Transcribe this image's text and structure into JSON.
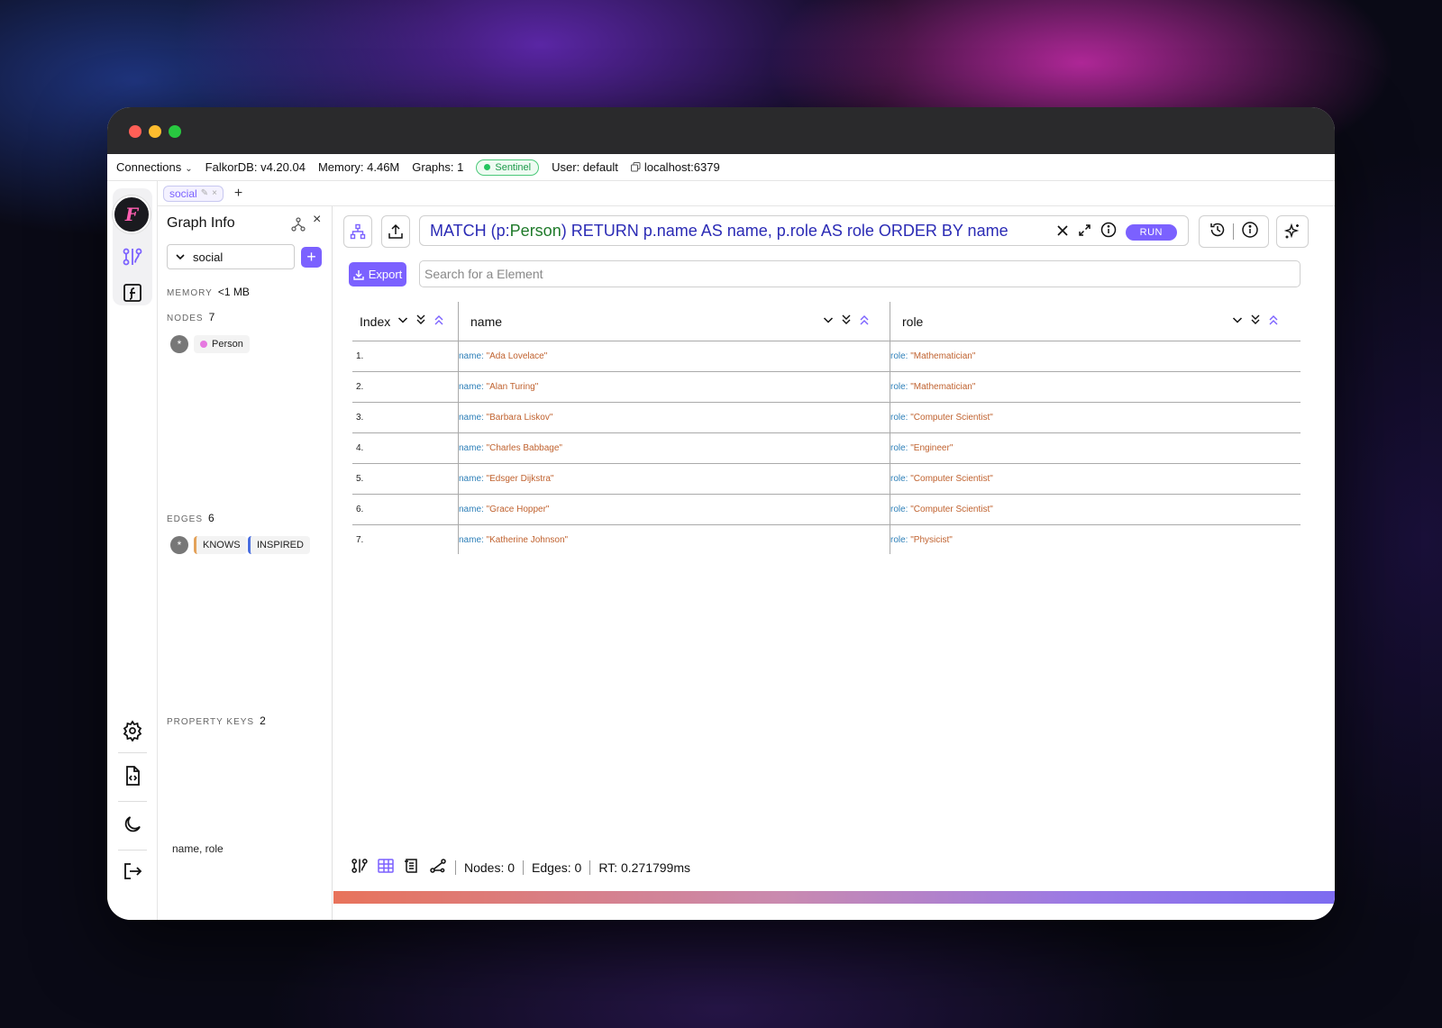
{
  "statusbar": {
    "connections_label": "Connections",
    "db_version": "FalkorDB: v4.20.04",
    "memory": "Memory: 4.46M",
    "graphs": "Graphs: 1",
    "badge": "Sentinel",
    "user": "User: default",
    "host": "localhost:6379"
  },
  "tabs": {
    "active_graph": "social",
    "add_label": "+"
  },
  "rail": {
    "logo_letter": "F"
  },
  "sidepanel": {
    "title": "Graph Info",
    "selected_graph": "social",
    "add_label": "+",
    "memory_label": "MEMORY",
    "memory_value": "<1 MB",
    "nodes_label": "NODES",
    "nodes_count": "7",
    "node_labels": [
      "Person"
    ],
    "edges_label": "EDGES",
    "edges_count": "6",
    "edge_types": [
      "KNOWS",
      "INSPIRED"
    ],
    "property_keys_label": "PROPERTY KEYS",
    "property_keys_count": "2",
    "property_keys": "name, role",
    "all_chip": "*"
  },
  "query": {
    "part1": "MATCH (p:",
    "label": "Person",
    "part2": ") RETURN p.name AS name, p.role AS role ORDER BY name",
    "run_label": "RUN"
  },
  "toolbar": {
    "export_label": "Export",
    "search_placeholder": "Search for a Element"
  },
  "table": {
    "columns": [
      "Index",
      "name",
      "role"
    ],
    "rows": [
      {
        "index": "1.",
        "name_key": "name:",
        "name": "\"Ada Lovelace\"",
        "role_key": "role:",
        "role": "\"Mathematician\""
      },
      {
        "index": "2.",
        "name_key": "name:",
        "name": "\"Alan Turing\"",
        "role_key": "role:",
        "role": "\"Mathematician\""
      },
      {
        "index": "3.",
        "name_key": "name:",
        "name": "\"Barbara Liskov\"",
        "role_key": "role:",
        "role": "\"Computer Scientist\""
      },
      {
        "index": "4.",
        "name_key": "name:",
        "name": "\"Charles Babbage\"",
        "role_key": "role:",
        "role": "\"Engineer\""
      },
      {
        "index": "5.",
        "name_key": "name:",
        "name": "\"Edsger Dijkstra\"",
        "role_key": "role:",
        "role": "\"Computer Scientist\""
      },
      {
        "index": "6.",
        "name_key": "name:",
        "name": "\"Grace Hopper\"",
        "role_key": "role:",
        "role": "\"Computer Scientist\""
      },
      {
        "index": "7.",
        "name_key": "name:",
        "name": "\"Katherine Johnson\"",
        "role_key": "role:",
        "role": "\"Physicist\""
      }
    ]
  },
  "footer": {
    "nodes": "Nodes: 0",
    "edges": "Edges: 0",
    "rt": "RT: 0.271799ms"
  },
  "colors": {
    "accent": "#7b61ff",
    "sentinel": "#22c55e",
    "person_dot": "#e679e0",
    "knows_edge": "#e3a25a",
    "inspired_edge": "#4a6ee0",
    "key_color": "#2d7fb8",
    "value_color": "#c0622f"
  }
}
